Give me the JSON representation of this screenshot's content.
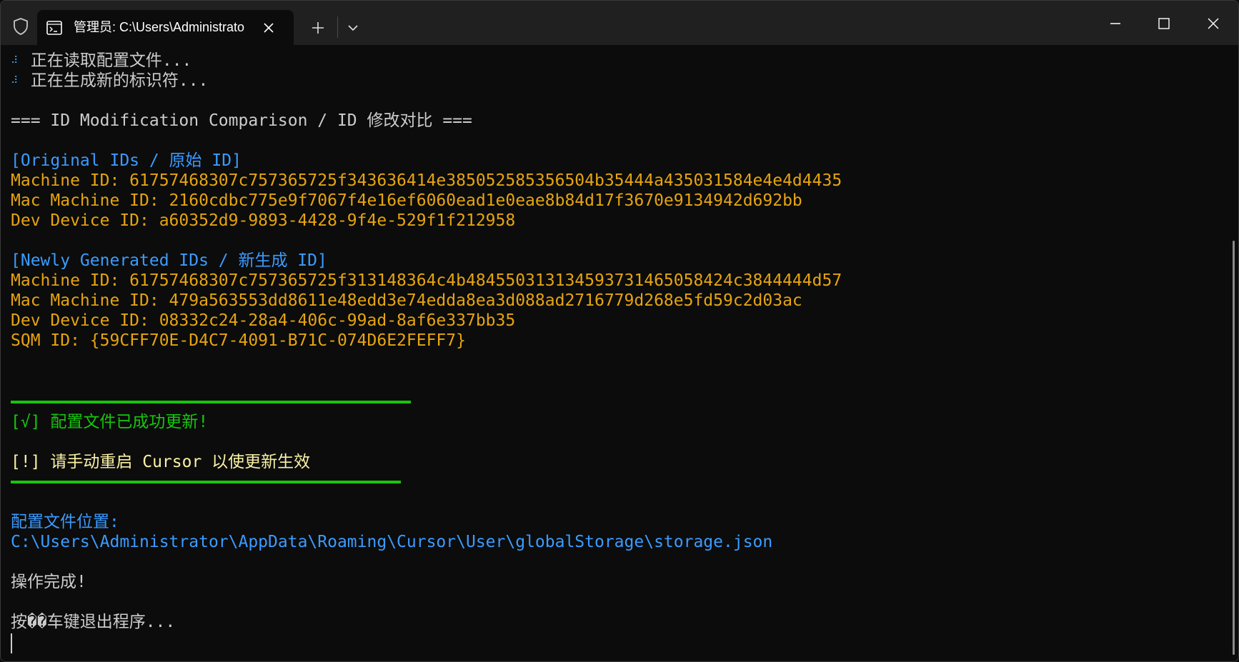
{
  "titlebar": {
    "tab_title": "管理员: C:\\Users\\Administrato",
    "icons": {
      "shield": "shield-icon",
      "terminal": "terminal-icon",
      "close_tab": "close-icon",
      "new_tab": "plus-icon",
      "dropdown": "chevron-down-icon",
      "minimize": "minimize-icon",
      "maximize": "maximize-icon",
      "close_window": "close-icon"
    }
  },
  "console": {
    "progress_1": "正在读取配置文件...",
    "progress_2": "正在生成新的标识符...",
    "comparison_header": "=== ID Modification Comparison / ID 修改对比 ===",
    "original_header": "[Original IDs / 原始 ID]",
    "original_ids": [
      "Machine ID: 61757468307c757365725f343636414e385052585356504b35444a435031584e4e4d4435",
      "Mac Machine ID: 2160cdbc775e9f7067f4e16ef6060ead1e0eae8b84d17f3670e9134942d692bb",
      "Dev Device ID: a60352d9-9893-4428-9f4e-529f1f212958"
    ],
    "new_header": "[Newly Generated IDs / 新生成 ID]",
    "new_ids": [
      "Machine ID: 61757468307c757365725f313148364c4b484550313134593731465058424c3844444d57",
      "Mac Machine ID: 479a563553dd8611e48edd3e74edda8ea3d088ad2716779d268e5fd59c2d03ac",
      "Dev Device ID: 08332c24-28a4-406c-99ad-8af6e337bb35",
      "SQM ID: {59CFF70E-D4C7-4091-B71C-074D6E2FEFF7}"
    ],
    "success_message": "[√] 配置文件已成功更新!",
    "restart_message": "[!] 请手动重启 Cursor 以使更新生效",
    "config_location_label": "配置文件位置:",
    "config_path": "C:\\Users\\Administrator\\AppData\\Roaming\\Cursor\\User\\globalStorage\\storage.json",
    "done_message": "操作完成!",
    "exit_prompt": "按��车键退出程序..."
  },
  "colors": {
    "background": "#0c0c0c",
    "titlebar": "#202020",
    "text": "#cccccc",
    "blue": "#3b9bff",
    "yellow": "#e5a410",
    "green": "#16c60c",
    "light_yellow": "#f9f1a5"
  }
}
